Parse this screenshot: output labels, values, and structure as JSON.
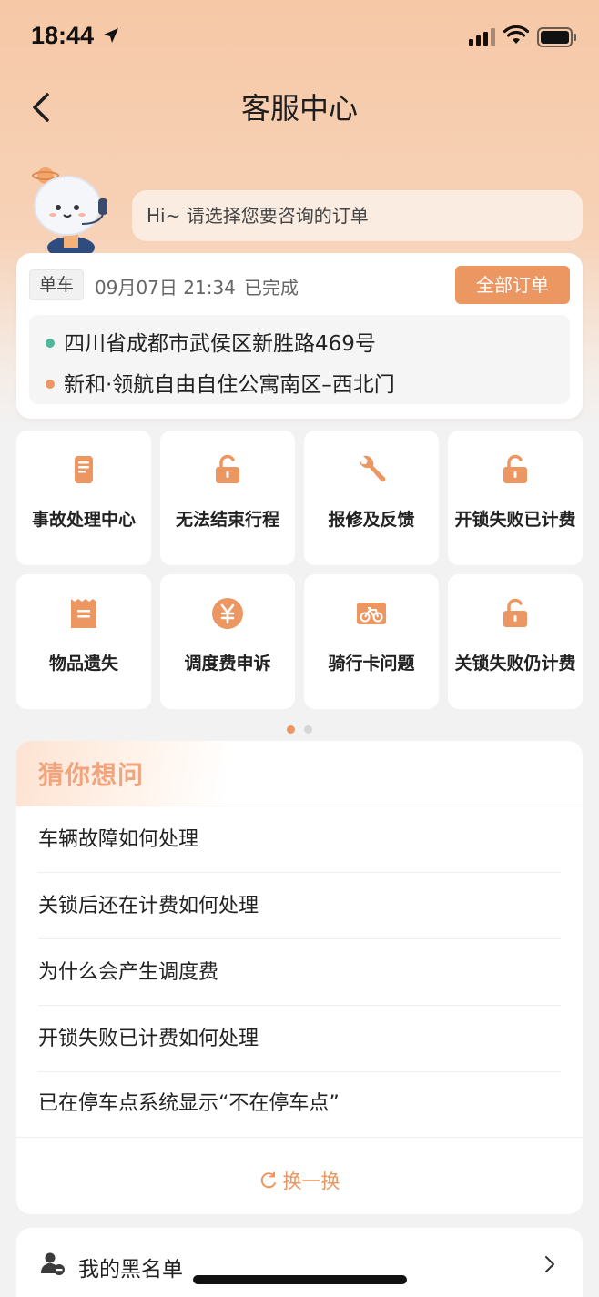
{
  "status_bar": {
    "time": "18:44"
  },
  "nav": {
    "title": "客服中心"
  },
  "greeting": {
    "text": "Hi~ 请选择您要咨询的订单"
  },
  "order": {
    "type": "单车",
    "datetime": "09月07日 21:34",
    "status": "已完成",
    "all_orders_label": "全部订单",
    "start": "四川省成都市武侯区新胜路469号",
    "end": "新和·领航自由自住公寓南区–西北门",
    "start_color": "#4fb79a",
    "end_color": "#ec9761"
  },
  "services": [
    {
      "label": "事故处理中心",
      "icon": "phone-document-icon"
    },
    {
      "label": "无法结束行程",
      "icon": "unlock-icon"
    },
    {
      "label": "报修及反馈",
      "icon": "wrench-icon"
    },
    {
      "label": "开锁失败已计费",
      "icon": "unlock-icon"
    },
    {
      "label": "物品遗失",
      "icon": "receipt-icon"
    },
    {
      "label": "调度费申诉",
      "icon": "yuan-icon"
    },
    {
      "label": "骑行卡问题",
      "icon": "bike-card-icon"
    },
    {
      "label": "关锁失败仍计费",
      "icon": "unlock-icon"
    }
  ],
  "pager": {
    "pages": 2,
    "current": 1
  },
  "faq": {
    "title": "猜你想问",
    "items": [
      "车辆故障如何处理",
      "关锁后还在计费如何处理",
      "为什么会产生调度费",
      "开锁失败已计费如何处理",
      "已在停车点系统显示“不在停车点”"
    ],
    "refresh_label": "换一换"
  },
  "blacklist": {
    "label": "我的黑名单"
  },
  "colors": {
    "accent": "#ec9761",
    "header_bg": "#f6c8a6"
  }
}
